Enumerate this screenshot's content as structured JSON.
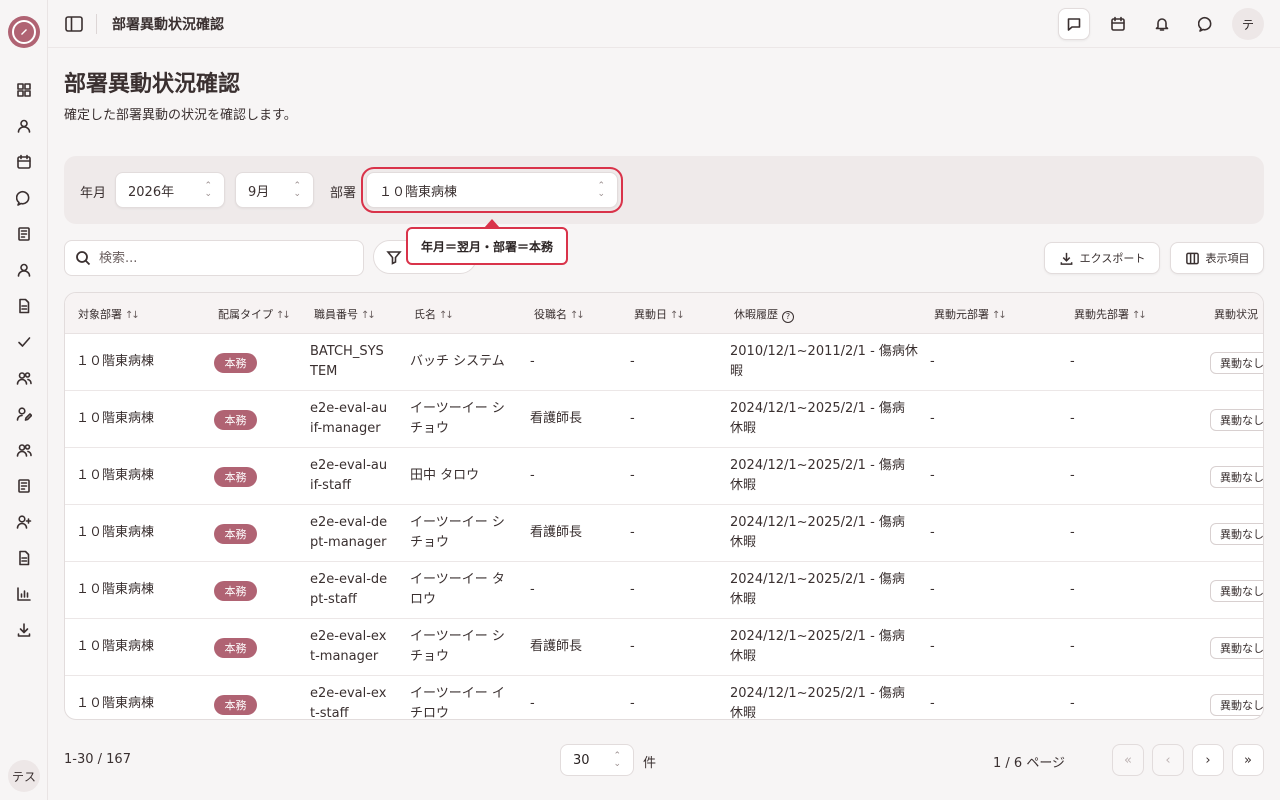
{
  "app": {
    "header_title": "部署異動状況確認",
    "user_initial": "テ",
    "sidebar_user": "テス"
  },
  "page": {
    "title": "部署異動状況確認",
    "subtitle": "確定した部署異動の状況を確認します。"
  },
  "filters": {
    "year_month_label": "年月",
    "year_value": "2026年",
    "month_value": "9月",
    "department_label": "部署",
    "department_value": "１０階東病棟",
    "tooltip": "年月＝翌月・部署＝本務"
  },
  "toolbar": {
    "search_placeholder": "検索...",
    "export_label": "エクスポート",
    "columns_label": "表示項目"
  },
  "table": {
    "headers": [
      "対象部署",
      "配属タイプ",
      "職員番号",
      "氏名",
      "役職名",
      "異動日",
      "休暇履歴",
      "異動元部署",
      "異動先部署",
      "異動状況"
    ],
    "rows": [
      {
        "dept": "１０階東病棟",
        "type": "本務",
        "id1": "BATCH_SYS",
        "id2": "TEM",
        "name1": "バッチ システム",
        "name2": "",
        "role": "-",
        "date": "-",
        "leave1": "2010/12/1~2011/2/1 - 傷病休",
        "leave2": "暇",
        "from": "-",
        "to": "-",
        "status": "異動なし"
      },
      {
        "dept": "１０階東病棟",
        "type": "本務",
        "id1": "e2e-eval-au",
        "id2": "if-manager",
        "name1": "イーツーイー シ",
        "name2": "チョウ",
        "role": "看護師長",
        "date": "-",
        "leave1": "2024/12/1~2025/2/1 - 傷病",
        "leave2": "休暇",
        "from": "-",
        "to": "-",
        "status": "異動なし"
      },
      {
        "dept": "１０階東病棟",
        "type": "本務",
        "id1": "e2e-eval-au",
        "id2": "if-staff",
        "name1": "田中 タロウ",
        "name2": "",
        "role": "-",
        "date": "-",
        "leave1": "2024/12/1~2025/2/1 - 傷病",
        "leave2": "休暇",
        "from": "-",
        "to": "-",
        "status": "異動なし"
      },
      {
        "dept": "１０階東病棟",
        "type": "本務",
        "id1": "e2e-eval-de",
        "id2": "pt-manager",
        "name1": "イーツーイー シ",
        "name2": "チョウ",
        "role": "看護師長",
        "date": "-",
        "leave1": "2024/12/1~2025/2/1 - 傷病",
        "leave2": "休暇",
        "from": "-",
        "to": "-",
        "status": "異動なし"
      },
      {
        "dept": "１０階東病棟",
        "type": "本務",
        "id1": "e2e-eval-de",
        "id2": "pt-staff",
        "name1": "イーツーイー タ",
        "name2": "ロウ",
        "role": "-",
        "date": "-",
        "leave1": "2024/12/1~2025/2/1 - 傷病",
        "leave2": "休暇",
        "from": "-",
        "to": "-",
        "status": "異動なし"
      },
      {
        "dept": "１０階東病棟",
        "type": "本務",
        "id1": "e2e-eval-ex",
        "id2": "t-manager",
        "name1": "イーツーイー シ",
        "name2": "チョウ",
        "role": "看護師長",
        "date": "-",
        "leave1": "2024/12/1~2025/2/1 - 傷病",
        "leave2": "休暇",
        "from": "-",
        "to": "-",
        "status": "異動なし"
      },
      {
        "dept": "１０階東病棟",
        "type": "本務",
        "id1": "e2e-eval-ex",
        "id2": "t-staff",
        "name1": "イーツーイー イ",
        "name2": "チロウ",
        "role": "-",
        "date": "-",
        "leave1": "2024/12/1~2025/2/1 - 傷病",
        "leave2": "休暇",
        "from": "-",
        "to": "-",
        "status": "異動なし"
      }
    ]
  },
  "pagination": {
    "range": "1-30 / 167",
    "page_size": "30",
    "unit": "件",
    "page_info": "1 / 6 ページ",
    "first": "«",
    "prev": "‹",
    "next": "›",
    "last": "»"
  },
  "colors": {
    "accent": "#b06373",
    "highlight": "#d9334a"
  }
}
